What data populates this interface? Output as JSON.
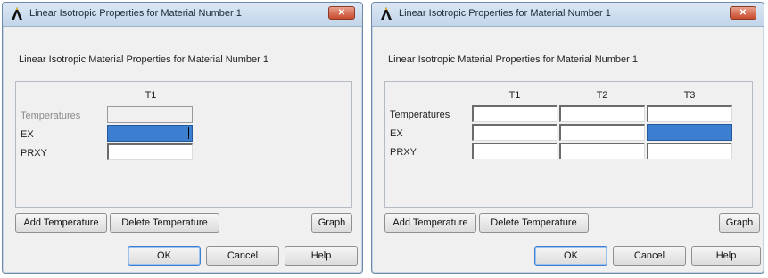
{
  "dialogs": [
    {
      "title": "Linear Isotropic Properties for Material Number 1",
      "heading": "Linear Isotropic Material Properties for Material Number 1",
      "columns": [
        "T1"
      ],
      "rows": [
        "Temperatures",
        "EX",
        "PRXY"
      ],
      "buttons": {
        "add_temperature": "Add Temperature",
        "delete_temperature": "Delete Temperature",
        "graph": "Graph",
        "ok": "OK",
        "cancel": "Cancel",
        "help": "Help"
      },
      "close_glyph": "✕"
    },
    {
      "title": "Linear Isotropic Properties for Material Number 1",
      "heading": "Linear Isotropic Material Properties for Material Number 1",
      "columns": [
        "T1",
        "T2",
        "T3"
      ],
      "rows": [
        "Temperatures",
        "EX",
        "PRXY"
      ],
      "buttons": {
        "add_temperature": "Add Temperature",
        "delete_temperature": "Delete Temperature",
        "graph": "Graph",
        "ok": "OK",
        "cancel": "Cancel",
        "help": "Help"
      },
      "close_glyph": "✕"
    }
  ],
  "icons": {
    "app": "ansys-logo-icon",
    "close": "close-icon"
  },
  "colors": {
    "selected_cell": "#3c7fd0",
    "close_button": "#c84a2c",
    "titlebar": "#c3d5ea"
  }
}
